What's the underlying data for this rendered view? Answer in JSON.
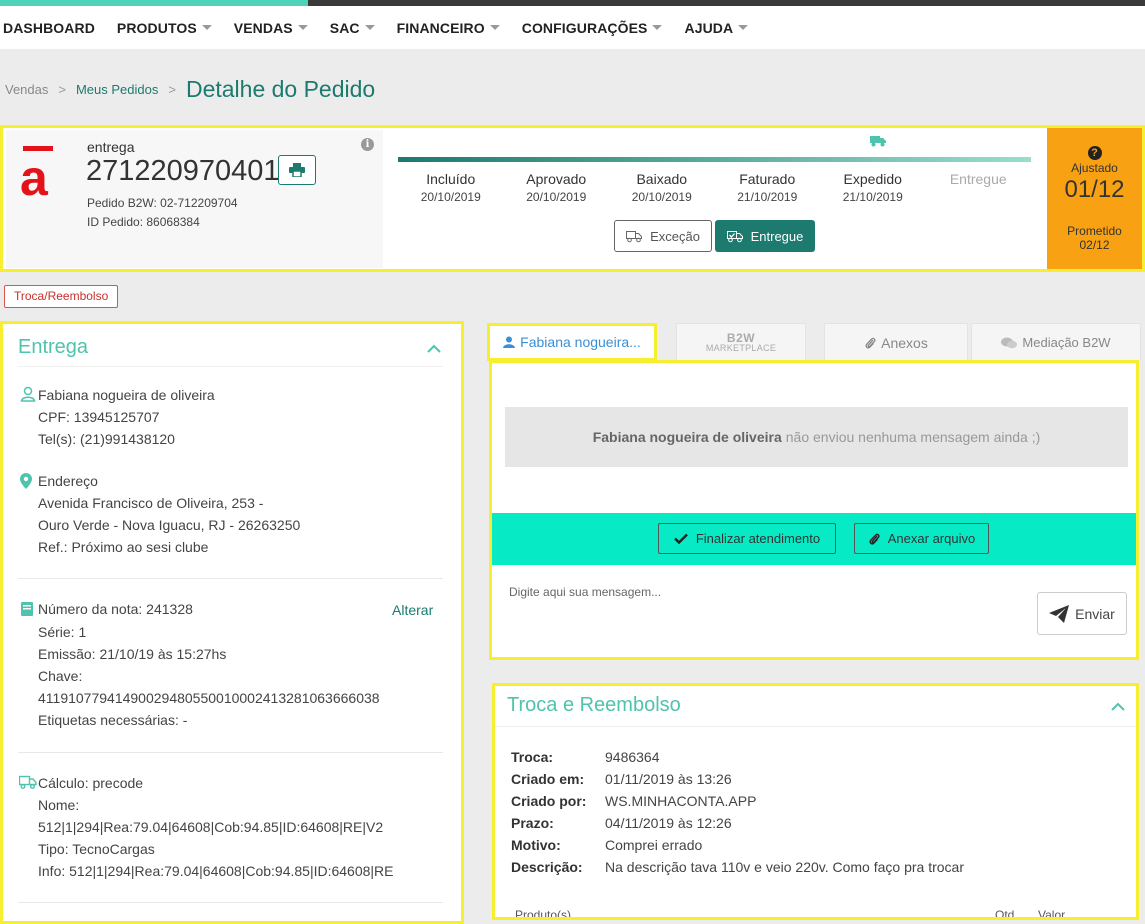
{
  "nav": {
    "items": [
      {
        "label": "DASHBOARD",
        "caret": false
      },
      {
        "label": "PRODUTOS",
        "caret": true
      },
      {
        "label": "VENDAS",
        "caret": true
      },
      {
        "label": "SAC",
        "caret": true
      },
      {
        "label": "FINANCEIRO",
        "caret": true
      },
      {
        "label": "CONFIGURAÇÕES",
        "caret": true
      },
      {
        "label": "AJUDA",
        "caret": true
      }
    ]
  },
  "breadcrumb": {
    "root": "Vendas",
    "sep": ">",
    "parent": "Meus Pedidos",
    "current": "Detalhe do Pedido"
  },
  "order": {
    "type": "entrega",
    "number": "271220970401",
    "pedido_b2w": "Pedido B2W: 02-712209704",
    "id_pedido": "ID Pedido: 86068384",
    "progress_fraction": 1.0,
    "steps": [
      {
        "label": "Incluído",
        "date": "20/10/2019",
        "done": true
      },
      {
        "label": "Aprovado",
        "date": "20/10/2019",
        "done": true
      },
      {
        "label": "Baixado",
        "date": "20/10/2019",
        "done": true
      },
      {
        "label": "Faturado",
        "date": "21/10/2019",
        "done": true
      },
      {
        "label": "Expedido",
        "date": "21/10/2019",
        "done": true
      },
      {
        "label": "Entregue",
        "date": "",
        "done": false
      }
    ],
    "btn_excecao": "Exceção",
    "btn_entregue": "Entregue",
    "deadline": {
      "ajustado_label": "Ajustado",
      "ajustado_date": "01/12",
      "prometido_label": "Prometido",
      "prometido_date": "02/12"
    }
  },
  "tag_troca": "Troca/Reembolso",
  "entrega": {
    "title": "Entrega",
    "customer_name": "Fabiana nogueira de oliveira",
    "cpf": "CPF: 13945125707",
    "tel": "Tel(s): (21)991438120",
    "address_label": "Endereço",
    "address_line1": "Avenida Francisco de Oliveira, 253 -",
    "address_line2": "Ouro Verde - Nova Iguacu, RJ - 26263250",
    "address_ref": "Ref.: Próximo ao sesi clube",
    "nota_label": "Número da nota: 241328",
    "alterar": "Alterar",
    "serie": "Série: 1",
    "emissao": "Emissão: 21/10/19 às 15:27hs",
    "chave_label": "Chave:",
    "chave": "41191077941490029480550010002413281063666038",
    "etiquetas": "Etiquetas necessárias: -",
    "calculo": "Cálculo: precode",
    "nome_label": "Nome:",
    "nome": "512|1|294|Rea:79.04|64608|Cob:94.85|ID:64608|RE|V2",
    "tipo": "Tipo: TecnoCargas",
    "info": "Info: 512|1|294|Rea:79.04|64608|Cob:94.85|ID:64608|RE"
  },
  "tabs": {
    "customer": "Fabiana nogueira...",
    "b2w_big": "B2W",
    "b2w_small": "MARKETPLACE",
    "anexos": "Anexos",
    "mediacao": "Mediação B2W"
  },
  "chat": {
    "empty_name": "Fabiana nogueira de oliveira",
    "empty_msg": "não enviou nenhuma mensagem ainda ;)",
    "btn_finalizar": "Finalizar atendimento",
    "btn_anexar": "Anexar arquivo",
    "placeholder": "Digite aqui sua mensagem...",
    "btn_enviar": "Enviar"
  },
  "troca": {
    "title": "Troca e Reembolso",
    "rows": [
      {
        "k": "Troca:",
        "v": "9486364"
      },
      {
        "k": "Criado em:",
        "v": "01/11/2019 às 13:26"
      },
      {
        "k": "Criado por:",
        "v": "WS.MINHACONTA.APP"
      },
      {
        "k": "Prazo:",
        "v": "04/11/2019 às 12:26"
      },
      {
        "k": "Motivo:",
        "v": "Comprei errado"
      },
      {
        "k": "Descrição:",
        "v": "Na descrição tava 110v e veio 220v. Como faço pra trocar"
      }
    ],
    "col_produto": "Produto(s)",
    "col_qtd": "Qtd",
    "col_valor": "Valor"
  },
  "colors": {
    "teal": "#1c7a6e",
    "mint": "#06ebc5",
    "orange": "#f8a112",
    "brand_red": "#e4131a",
    "highlight": "#f7ee2f"
  }
}
